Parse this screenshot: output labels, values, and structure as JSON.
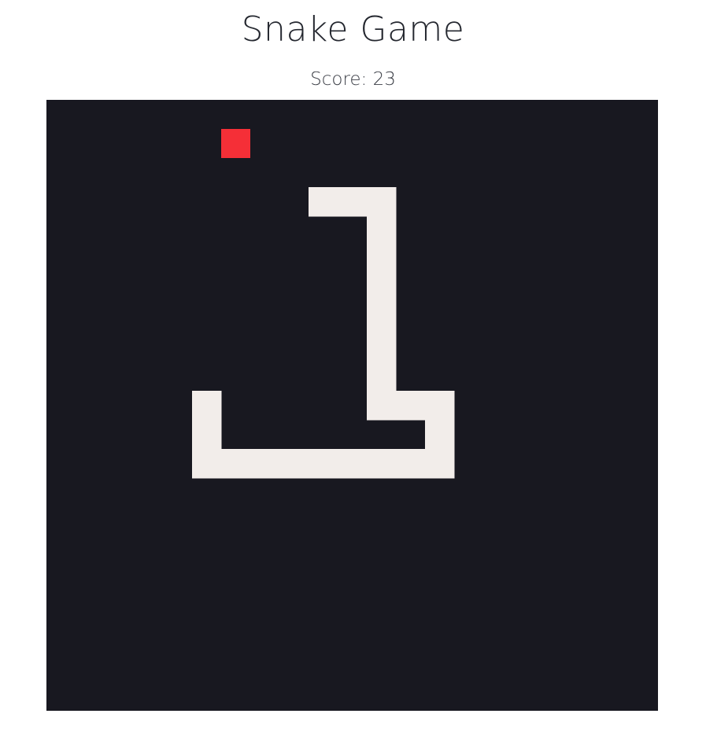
{
  "title": "Snake Game",
  "score": {
    "label": "Score: 23",
    "value": 23
  },
  "board": {
    "columns": 21,
    "rows": 21,
    "background_color": "#181820",
    "snake_color": "#f2edea",
    "food_color": "#f52f37"
  },
  "food": {
    "col": 6,
    "row": 1
  },
  "snake": {
    "segments": [
      [
        5,
        10
      ],
      [
        5,
        11
      ],
      [
        5,
        12
      ],
      [
        6,
        12
      ],
      [
        7,
        12
      ],
      [
        8,
        12
      ],
      [
        9,
        12
      ],
      [
        10,
        12
      ],
      [
        11,
        12
      ],
      [
        12,
        12
      ],
      [
        13,
        12
      ],
      [
        13,
        11
      ],
      [
        13,
        10
      ],
      [
        12,
        10
      ],
      [
        11,
        10
      ],
      [
        11,
        9
      ],
      [
        11,
        8
      ],
      [
        11,
        7
      ],
      [
        11,
        6
      ],
      [
        11,
        5
      ],
      [
        11,
        4
      ],
      [
        11,
        3
      ],
      [
        10,
        3
      ],
      [
        9,
        3
      ]
    ]
  }
}
